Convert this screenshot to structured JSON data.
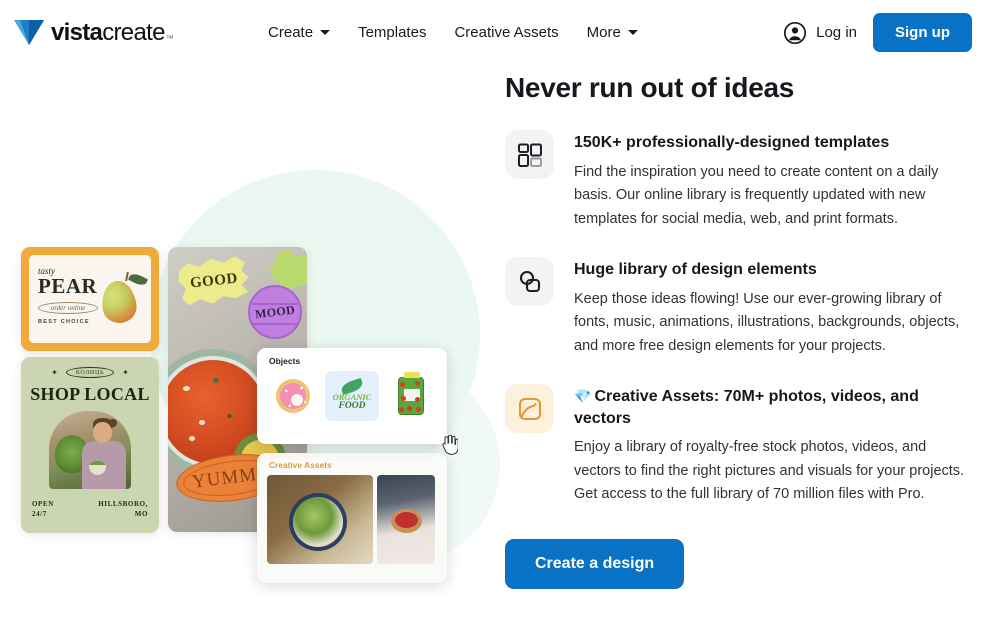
{
  "header": {
    "logo": {
      "bold": "vista",
      "regular": "create",
      "tm": "™",
      "icon": "vistacreate-logo-icon"
    },
    "nav": [
      {
        "label": "Create",
        "has_caret": true
      },
      {
        "label": "Templates",
        "has_caret": false
      },
      {
        "label": "Creative Assets",
        "has_caret": false
      },
      {
        "label": "More",
        "has_caret": true
      }
    ],
    "login_label": "Log in",
    "signup_label": "Sign up",
    "accent_color": "#0a72c4"
  },
  "hero": {
    "title": "Never run out of ideas",
    "cta_label": "Create a design",
    "features": [
      {
        "icon": "templates-grid-icon",
        "icon_bg": "#f3f3f3",
        "title": "150K+ professionally-designed templates",
        "text": "Find the inspiration you need to create content on a daily basis. Our online library is frequently updated with new templates for social media, web, and print formats."
      },
      {
        "icon": "shapes-elements-icon",
        "icon_bg": "#f3f3f3",
        "title": "Huge library of design elements",
        "text": "Keep those ideas flowing! Use our ever-growing library of fonts, music, animations, illustrations, backgrounds, objects, and more free design elements for your projects."
      },
      {
        "icon": "image-photo-icon",
        "icon_bg": "#fdf0dd",
        "gem": "💎",
        "title": "Creative Assets: 70M+ photos, videos, and vectors",
        "text": "Enjoy a library of royalty-free stock photos, videos, and vectors to find the right pictures and visuals for your projects. Get access to the full library of 70 million files with Pro."
      }
    ]
  },
  "illustration": {
    "pear_card": {
      "tasty": "tasty",
      "title": "PEAR",
      "order": "order online",
      "best": "BEST CHOICE"
    },
    "shop_card": {
      "badge": "КОЛИЦЬ",
      "title": "SHOP LOCAL",
      "open": "OPEN\n24/7",
      "location": "HILLSBORO,\nMO"
    },
    "stickers": {
      "good": "GOOD",
      "mood": "MOOD",
      "yummy": "YUMMY"
    },
    "objects_panel": {
      "label": "Objects",
      "items": [
        {
          "name": "donut-object",
          "selected": false
        },
        {
          "name": "organic-food-object",
          "selected": true,
          "line1": "ORGANIC",
          "line2": "FOOD"
        },
        {
          "name": "pickle-jar-object",
          "selected": false
        }
      ]
    },
    "assets_panel": {
      "label": "Creative Assets",
      "items": [
        {
          "name": "salad-bowl-photo"
        },
        {
          "name": "tart-photo"
        }
      ]
    },
    "cursor": "hand-pointer-cursor"
  }
}
